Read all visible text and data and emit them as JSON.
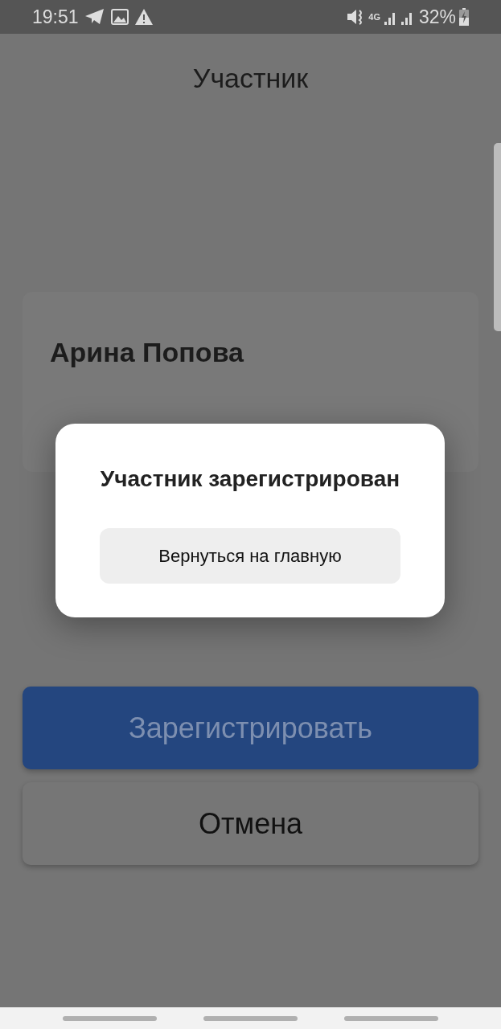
{
  "status_bar": {
    "time": "19:51",
    "network": "4G",
    "battery": "32%"
  },
  "title": "Участник",
  "participant": {
    "name": "Арина Попова"
  },
  "actions": [
    {
      "label": "Зарегистрировать",
      "kind": "primary"
    },
    {
      "label": "Отмена",
      "kind": "secondary"
    }
  ],
  "dialog": {
    "title": "Участник зарегистрирован",
    "button": "Вернуться на главную"
  }
}
